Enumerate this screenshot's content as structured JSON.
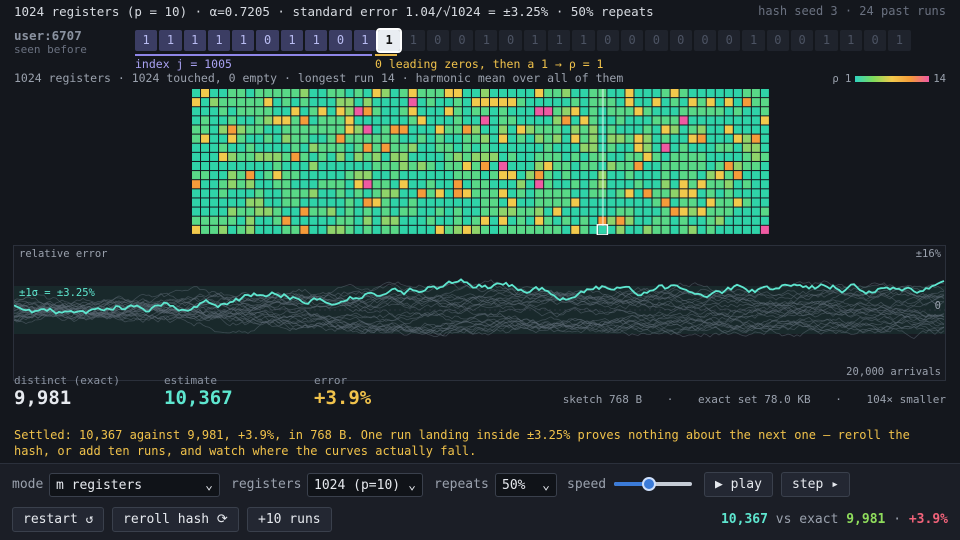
{
  "header": {
    "title": "1024 registers (p = 10) · α=0.7205 · standard error 1.04/√1024 = ±3.25% · 50% repeats",
    "seed_info": "hash seed 3 · 24 past runs"
  },
  "hash": {
    "user": "user:6707",
    "seen": "seen before",
    "index_bits": [
      "1",
      "1",
      "1",
      "1",
      "1",
      "0",
      "1",
      "1",
      "0",
      "1"
    ],
    "leading_bits": [],
    "one_bit": "1",
    "rest_bits": [
      "1",
      "0",
      "0",
      "1",
      "0",
      "1",
      "1",
      "1",
      "0",
      "0",
      "0",
      "0",
      "0",
      "0",
      "1",
      "0",
      "0",
      "1",
      "1",
      "0",
      "1"
    ],
    "index_label": "index j = 1005",
    "lead_label": "0 leading zeros, then a 1  →  ρ = 1"
  },
  "summary": "1024 registers · 1024 touched, 0 empty · longest run 14 · harmonic mean over all of them",
  "legend": {
    "low": "ρ 1",
    "high": "14"
  },
  "registers": {
    "count": 1024,
    "highlight_index": 1005,
    "colors": [
      "#2fd3a8",
      "#59d887",
      "#8fd36a",
      "#f2c94c",
      "#f59b3a",
      "#ef5aa2"
    ]
  },
  "error_panel": {
    "label": "relative error",
    "top_value": "±16%",
    "band_label": "±1σ = ±3.25%",
    "zero_label": "0",
    "arrivals": "20,000 arrivals",
    "colors": {
      "current": "#5ee6cf",
      "past": "#5d6a74",
      "band": "#1d3b38"
    }
  },
  "stats": {
    "distinct_label": "distinct (exact)",
    "distinct_value": "9,981",
    "estimate_label": "estimate",
    "estimate_value": "10,367",
    "error_label": "error",
    "error_value": "+3.9%",
    "sketch": "sketch 768 B",
    "exact": "exact set 78.0 KB",
    "ratio": "104× smaller",
    "sep": "·"
  },
  "message": "Settled: 10,367 against 9,981, +3.9%, in 768 B. One run landing inside ±3.25% proves nothing about the next one — reroll the hash, or add ten runs, and watch where the curves actually fall.",
  "controls": {
    "mode_label": "mode",
    "mode_value": "m registers",
    "registers_label": "registers",
    "registers_value": "1024 (p=10)",
    "repeats_label": "repeats",
    "repeats_value": "50%",
    "speed_label": "speed",
    "speed_level": 0.45,
    "play_label": "▶ play",
    "step_label": "step ▸",
    "restart_label": "restart ↺",
    "reroll_label": "reroll hash ⟳",
    "add_runs_label": "+10 runs",
    "chevron": "⌄"
  },
  "final": {
    "estimate": "10,367",
    "vs": "vs exact",
    "exact": "9,981",
    "sep": "·",
    "error": "+3.9%"
  },
  "accent": {
    "teal": "#5ee6cf",
    "gold": "#f0c24b",
    "red": "#f2637a"
  }
}
